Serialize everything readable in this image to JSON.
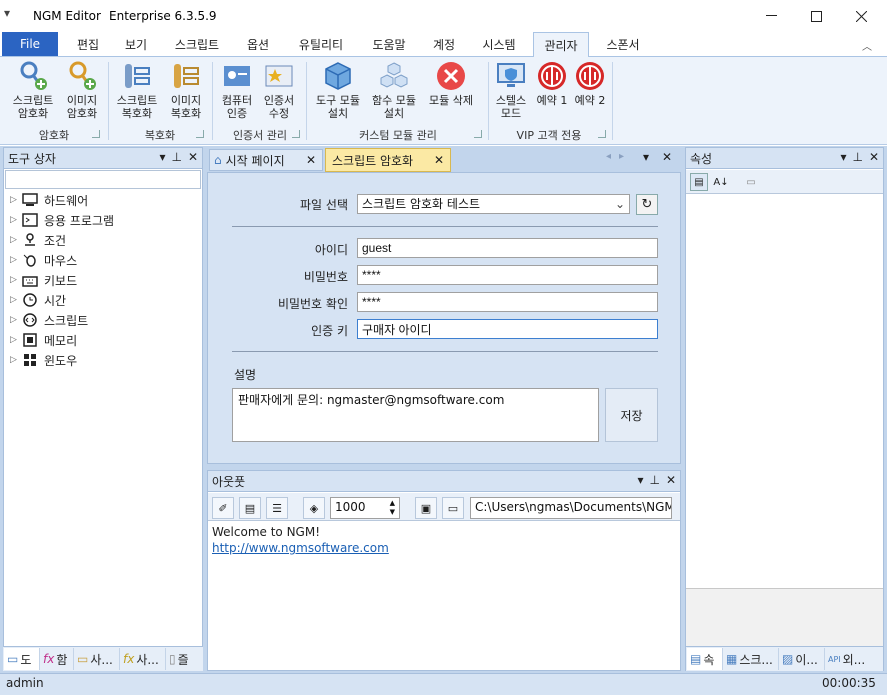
{
  "window": {
    "menu_glyph": "▾",
    "app_name": "NGM Editor",
    "edition": "Enterprise 6.3.5.9"
  },
  "ribbon_tabs": [
    "File",
    "편집",
    "보기",
    "스크립트",
    "옵션",
    "유틸리티",
    "도움말",
    "계정",
    "시스템",
    "관리자",
    "스폰서"
  ],
  "ribbon": {
    "buttons": [
      {
        "label1": "스크립트",
        "label2": "암호화"
      },
      {
        "label1": "이미지",
        "label2": "암호화"
      },
      {
        "label1": "스크립트",
        "label2": "복호화"
      },
      {
        "label1": "이미지",
        "label2": "복호화"
      },
      {
        "label1": "컴퓨터",
        "label2": "인증"
      },
      {
        "label1": "인증서",
        "label2": "수정"
      },
      {
        "label1": "도구 모듈",
        "label2": "설치"
      },
      {
        "label1": "함수 모듈",
        "label2": "설치"
      },
      {
        "label1": "모듈 삭제",
        "label2": ""
      },
      {
        "label1": "스텔스",
        "label2": "모드"
      },
      {
        "label1": "예약 1",
        "label2": ""
      },
      {
        "label1": "예약 2",
        "label2": ""
      }
    ],
    "groups": [
      "암호화",
      "복호화",
      "인증서 관리",
      "커스텀 모듈 관리",
      "VIP 고객 전용"
    ]
  },
  "toolbox": {
    "title": "도구 상자",
    "items": [
      {
        "label": "하드웨어",
        "icon": "monitor-icon"
      },
      {
        "label": "응용 프로그램",
        "icon": "console-icon"
      },
      {
        "label": "조건",
        "icon": "branch-icon"
      },
      {
        "label": "마우스",
        "icon": "mouse-icon"
      },
      {
        "label": "키보드",
        "icon": "keyboard-icon"
      },
      {
        "label": "시간",
        "icon": "clock-icon"
      },
      {
        "label": "스크립트",
        "icon": "script-icon"
      },
      {
        "label": "메모리",
        "icon": "memory-icon"
      },
      {
        "label": "윈도우",
        "icon": "windows-icon"
      }
    ],
    "bottom_tabs": [
      "도",
      "함",
      "사...",
      "사...",
      "즐"
    ]
  },
  "doc_tabs": {
    "start": "시작 페이지",
    "active": "스크립트 암호화"
  },
  "form": {
    "file_label": "파일 선택",
    "file_value": "스크립트 암호화 테스트",
    "id_label": "아이디",
    "id_value": "guest",
    "pw_label": "비밀번호",
    "pw_value": "****",
    "pw_confirm_label": "비밀번호 확인",
    "pw_confirm_value": "****",
    "key_label": "인증 키",
    "key_value": "구매자 아이디",
    "desc_label": "설명",
    "desc_value": "판매자에게 문의: ngmaster@ngmsoftware.com",
    "save_label": "저장"
  },
  "output": {
    "title": "아웃풋",
    "line_count": "1000",
    "path": "C:\\Users\\ngmas\\Documents\\NGM6\\",
    "welcome": "Welcome to NGM!",
    "link": "http://www.ngmsoftware.com"
  },
  "properties": {
    "title": "속성",
    "bottom_tabs": [
      "속",
      "스크...",
      "이...",
      "외..."
    ]
  },
  "status": {
    "user": "admin",
    "timer": "00:00:35"
  }
}
